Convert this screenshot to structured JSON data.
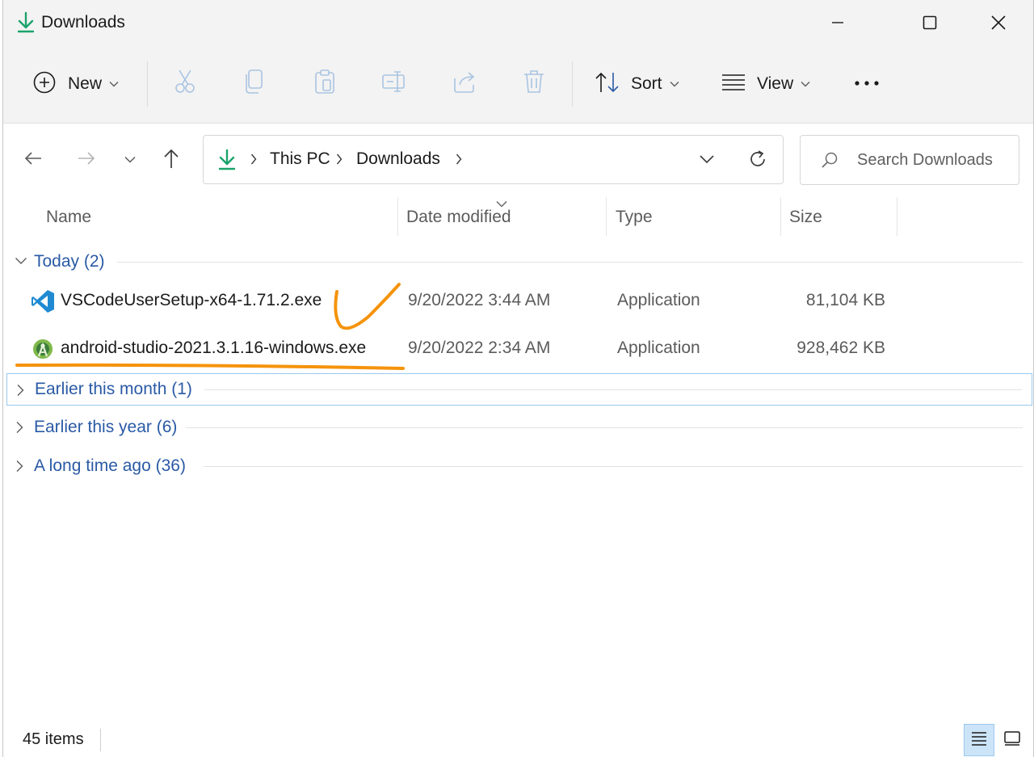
{
  "window": {
    "title": "Downloads",
    "accent_color": "#1aa36b",
    "annotation_color": "#f5930c"
  },
  "toolbar": {
    "new_label": "New",
    "sort_label": "Sort",
    "view_label": "View",
    "icons": [
      "cut-icon",
      "copy-icon",
      "paste-icon",
      "rename-icon",
      "share-icon",
      "delete-icon"
    ]
  },
  "address": {
    "crumbs": [
      "This PC",
      "Downloads"
    ]
  },
  "search": {
    "placeholder": "Search Downloads"
  },
  "columns": {
    "name": "Name",
    "date": "Date modified",
    "type": "Type",
    "size": "Size"
  },
  "groups": {
    "today": "Today (2)",
    "earlier_month": "Earlier this month (1)",
    "earlier_year": "Earlier this year (6)",
    "long_ago": "A long time ago (36)"
  },
  "files": [
    {
      "name": "VSCodeUserSetup-x64-1.71.2.exe",
      "date": "9/20/2022 3:44 AM",
      "type": "Application",
      "size": "81,104 KB",
      "icon": "vscode-icon"
    },
    {
      "name": "android-studio-2021.3.1.16-windows.exe",
      "date": "9/20/2022 2:34 AM",
      "type": "Application",
      "size": "928,462 KB",
      "icon": "android-studio-icon"
    }
  ],
  "status": {
    "count": "45 items"
  }
}
